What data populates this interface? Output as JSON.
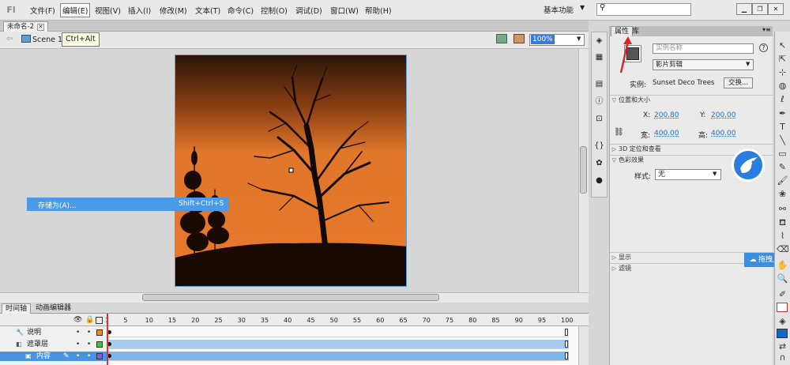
{
  "menubar": {
    "items": [
      "文件(F)",
      "编辑(E)",
      "视图(V)",
      "插入(I)",
      "修改(M)",
      "文本(T)",
      "命令(C)",
      "控制(O)",
      "调试(D)",
      "窗口(W)",
      "帮助(H)"
    ],
    "workspace": "基本功能"
  },
  "document": {
    "tab": "未命名-2",
    "scene": "Scene 1",
    "tooltip": "Ctrl+Alt",
    "zoom": "100%"
  },
  "context_menu": {
    "label": "存储为(A)...",
    "shortcut": "Shift+Ctrl+S"
  },
  "timeline": {
    "tabs": [
      "时间轴",
      "动画编辑器"
    ],
    "ruler": [
      "1",
      "5",
      "10",
      "15",
      "20",
      "25",
      "30",
      "35",
      "40",
      "45",
      "50",
      "55",
      "60",
      "65",
      "70",
      "75",
      "80",
      "85",
      "90",
      "95",
      "100"
    ],
    "layers": [
      {
        "name": "说明",
        "color": "#f08a18"
      },
      {
        "name": "遮罩层",
        "color": "#38c83a"
      },
      {
        "name": "内容",
        "color": "#8a5ad0"
      }
    ]
  },
  "panel": {
    "tabs": [
      "属性",
      "库"
    ],
    "instance_name_placeholder": "实例名称",
    "type": "影片剪辑",
    "instance_label": "实例:",
    "instance_value": "Sunset Deco Trees",
    "swap": "交换...",
    "sections": [
      "位置和大小",
      "3D 定位和查看",
      "色彩效果",
      "显示",
      "滤镜"
    ],
    "x_label": "X:",
    "x": "200.80",
    "y_label": "Y:",
    "y": "200.00",
    "w_label": "宽:",
    "w": "400.00",
    "h_label": "高:",
    "h": "400.00",
    "style_label": "样式:",
    "style": "无",
    "drag_hint": "拖拽上"
  },
  "colors": {
    "accent": "#3a7bd5",
    "sunset": "#e0772a"
  }
}
